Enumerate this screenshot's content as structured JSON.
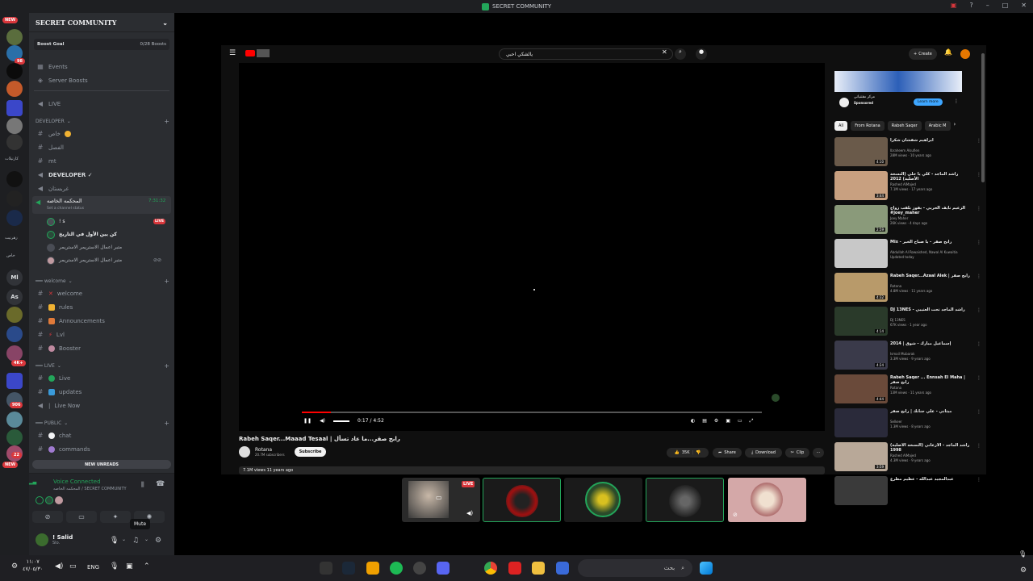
{
  "window": {
    "title": "SECRET COMMUNITY"
  },
  "rail": {
    "new_top": "NEW",
    "new_bottom": "NEW",
    "badge_98": "98",
    "badge_4k": "4K+",
    "badge_906": "906",
    "badge_22": "22",
    "initials_ml": "Ml",
    "initials_as": "As",
    "labels": [
      "كارتيلات",
      "زهرنيت",
      "خاص"
    ]
  },
  "sidebar": {
    "server_name": "SECRET COMMUNITY",
    "boost_goal": "Boost Goal",
    "boost_count": "0/28 Boosts",
    "events": "Events",
    "server_boosts": "Server Boosts",
    "live_channel": "LIVE",
    "cat_developer": "DEVELOPER",
    "ch_khas": "خاص",
    "ch_alfasl": "الفصل",
    "ch_mt": "mt",
    "ch_developer_voice": "DEVELOPER ✓",
    "ch_gharbistan": "غربستان",
    "active_voice": "المحكمه الخاصه",
    "active_voice_timer": "7:31:32",
    "set_status": "Set a channel status",
    "voice_users": [
      "! s",
      "كن يين الأول في التاريخ",
      "متبر اعمال الاستريمر الاستريمر",
      "متبر اعمال الاستريمر الاستريمر"
    ],
    "live_badge": "LIVE",
    "cat_welcome": "welcome",
    "ch_welcome": "welcome",
    "ch_rules": "rules",
    "ch_announcements": "Announcements",
    "ch_lvl": "Lvl",
    "ch_booster": "Booster",
    "cat_live": "LIVE",
    "ch_live": "Live",
    "ch_updates": "updates",
    "ch_live_now": "Live Now",
    "cat_public": "PUBLIC",
    "ch_chat": "chat",
    "ch_commands": "commands",
    "new_unreads": "NEW UNREADS"
  },
  "voice_panel": {
    "status": "Voice Connected",
    "location": "المحكمه الخاصه / SECRET COMMUNITY",
    "username": "! Salid",
    "user_status": "Slo.",
    "tooltip": "Mute"
  },
  "youtube": {
    "search_value": "يالشكي احبي",
    "create_label": "Create",
    "video_time": "0:17 / 4:52",
    "video_title": "Rabeh Saqer...Maaad Tesaal | رابح صقر...ما عاد تسأل",
    "channel_name": "Rotana",
    "channel_subs": "20.7M subscribers",
    "subscribe": "Subscribe",
    "likes": "35K",
    "share": "Share",
    "download": "Download",
    "clip": "Clip",
    "stats": "7.1M views  11 years ago",
    "ad_sponsor": "Sponsored",
    "ad_name": "مركز مقتنياتي",
    "ad_cta": "Learn more",
    "chips": [
      "All",
      "From Rotana",
      "Rabeh Saqer",
      "Arabic M"
    ],
    "recommendations": [
      {
        "title": "ابراهيم شقشان شكرا",
        "channel": "Ibraheem Alsufien",
        "views": "28M views · 10 years ago",
        "dur": "4:10"
      },
      {
        "title": "راشد الماجد - كلي يا حلي (النسخة الأصلية) 2012",
        "channel": "Rashed AlMajed",
        "views": "7.1M views · 17 years ago",
        "dur": "3:44"
      },
      {
        "title": "الزعيم نايف الحربي - يفوز بلقب زواج #joey_maher",
        "channel": "Joey Maher",
        "views": "26K views · 4 days ago",
        "dur": "2:59"
      },
      {
        "title": "Mix - رابح صقر - يا صباح الخير",
        "channel": "Abdullah Al Rowaished, Nawal Al Kuwaitia",
        "views": "Updated today",
        "dur": ""
      },
      {
        "title": "Rabeh Saqer...Azaal Alek | رابح صقر",
        "channel": "Rotana",
        "views": "4.8M views · 11 years ago",
        "dur": "4:32"
      },
      {
        "title": "DJ 13NES - راشد الماجد تحت العتيبي",
        "channel": "DJ 13NES",
        "views": "67K views · 1 year ago",
        "dur": "4:14"
      },
      {
        "title": "إسماعيل مبارك - شوق | 2014",
        "channel": "Ismail Mubarak",
        "views": "3.3M views · 9 years ago",
        "dur": "4:24"
      },
      {
        "title": "Rabeh Saqer ... Ennsah El Maha | رابح صقر",
        "channel": "Rotana",
        "views": "13M views · 11 years ago",
        "dur": "4:44"
      },
      {
        "title": "ميثاني - علي جنانك | رابح صقر",
        "channel": "Selkeer",
        "views": "1.3M views · 8 years ago",
        "dur": ""
      },
      {
        "title": "راشد الماجد - الأزعاني (النسخة الأصلية) 1998",
        "channel": "Rashed AlMajed",
        "views": "4.3M views · 9 years ago",
        "dur": "3:59"
      },
      {
        "title": "عبدالمجيد عبدالله - عظيم مطرع",
        "channel": "",
        "views": "",
        "dur": ""
      }
    ]
  },
  "taskbar": {
    "time": "١١:٠٧",
    "date": "٤٧/٠٥/٣٠",
    "lang": "ENG",
    "search_placeholder": "بحث"
  },
  "colors": {
    "discord_green": "#23a55a",
    "discord_red": "#da373c",
    "yt_red": "#ff0000"
  }
}
